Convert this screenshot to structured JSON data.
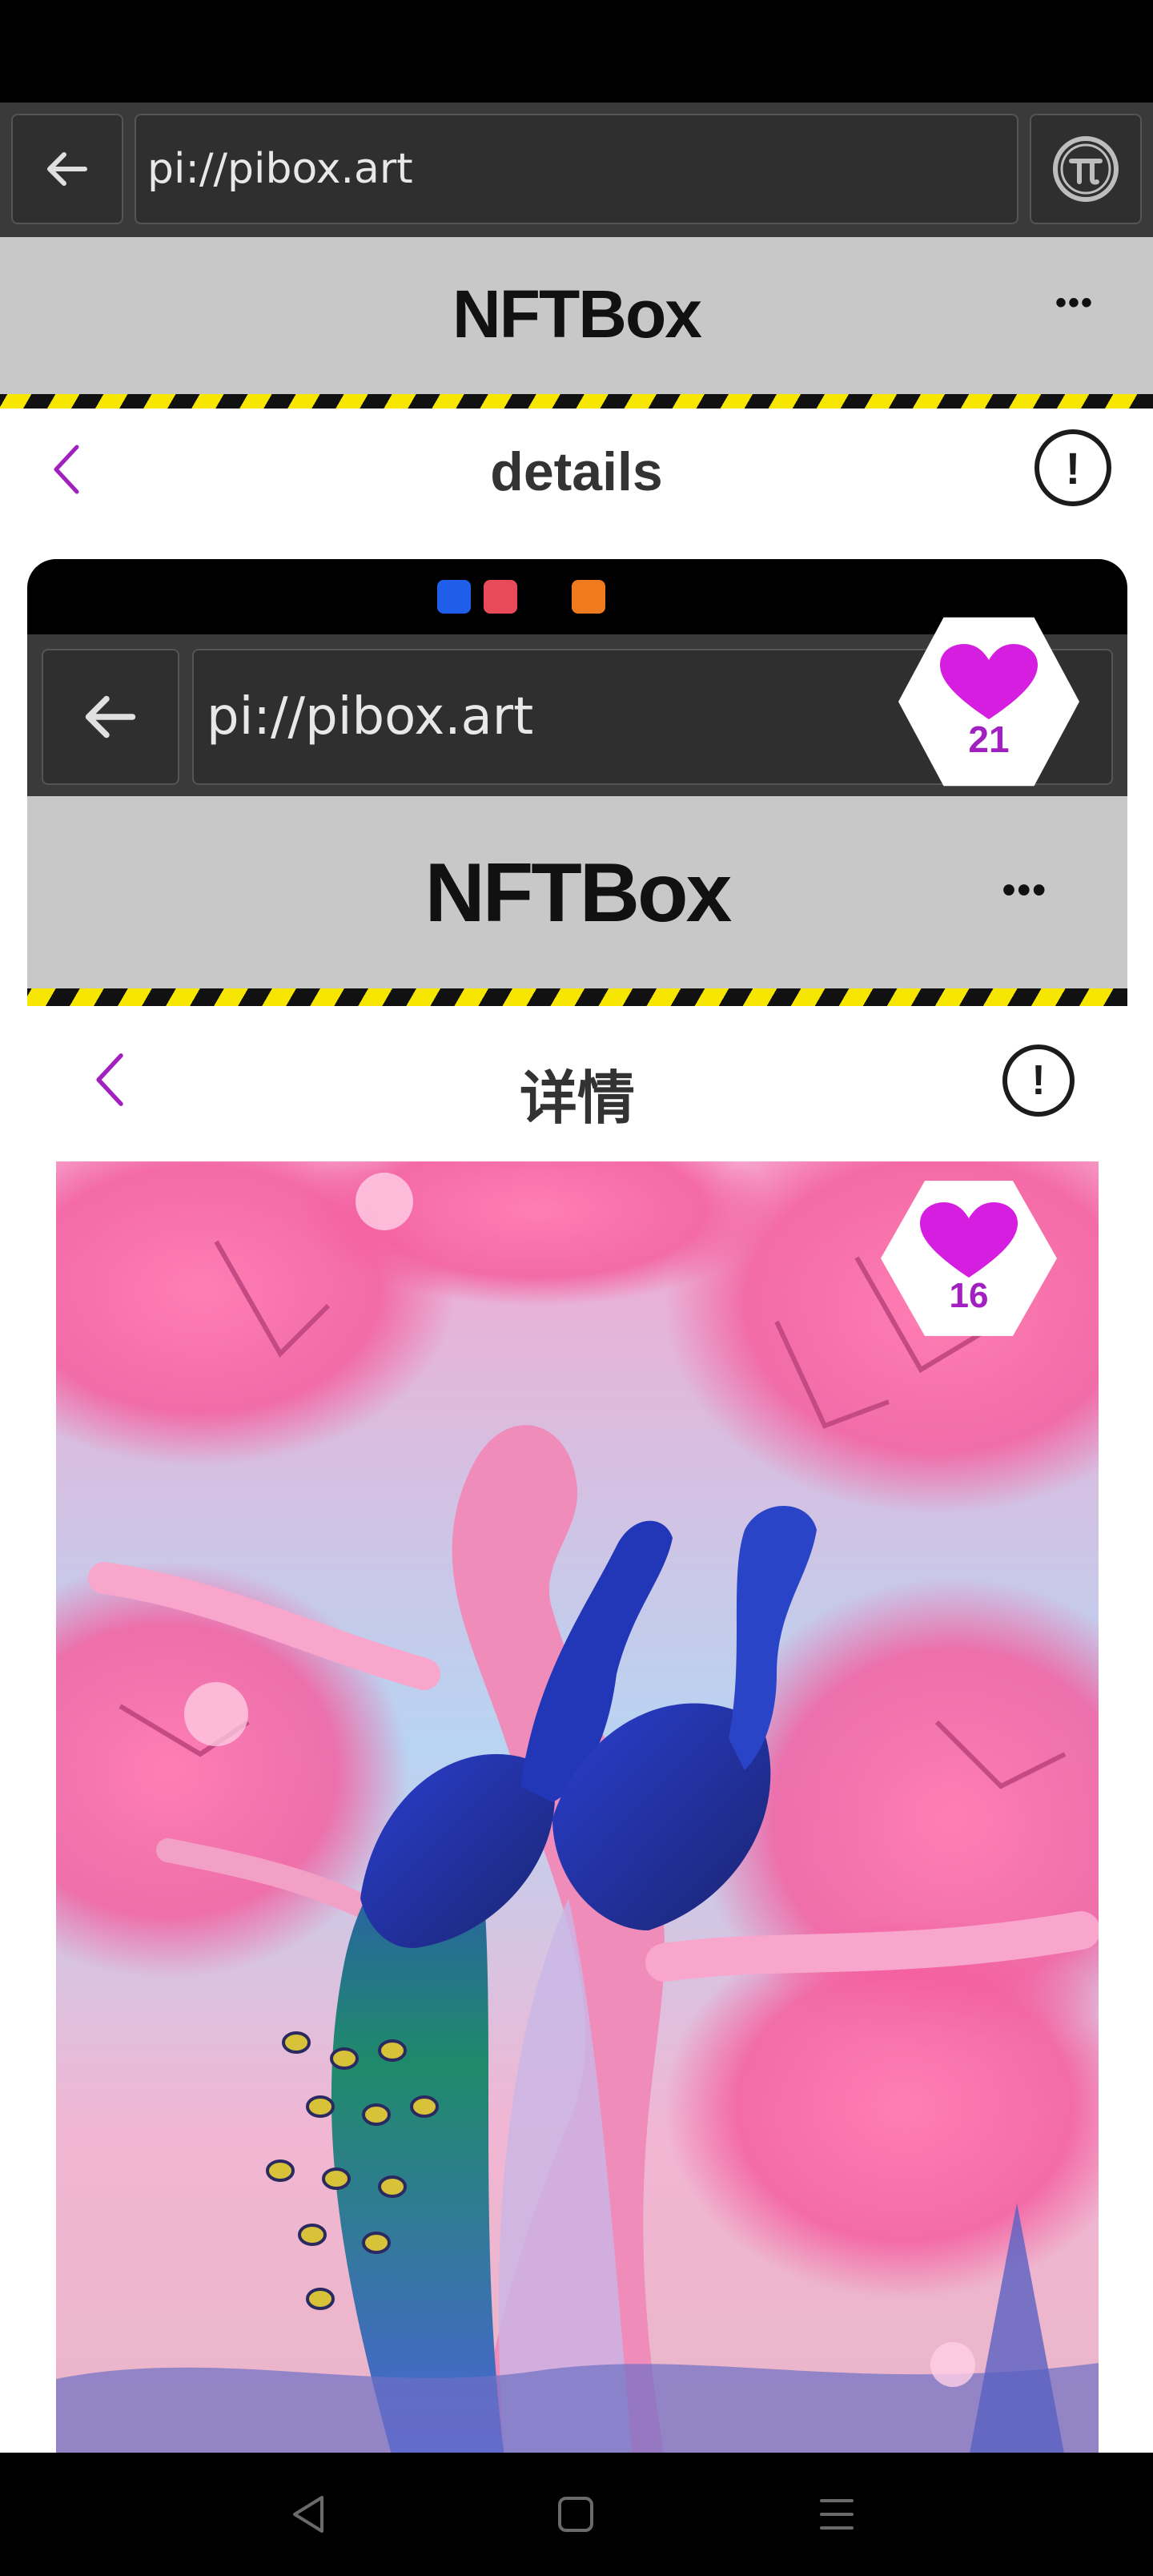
{
  "browser": {
    "url": "pi://pibox.art",
    "back_icon": "arrow-left-icon",
    "pi_icon": "pi-logo-icon"
  },
  "app": {
    "title": "NFTBox",
    "more_label": "•••"
  },
  "details": {
    "title": "details",
    "back_icon": "chevron-left-icon",
    "report_icon": "exclamation-circle-icon"
  },
  "like_badge": {
    "count": "21"
  },
  "inner_screenshot": {
    "url": "pi://pibox.art",
    "app_title": "NFTBox",
    "more_label": "•••",
    "details_title": "详情",
    "like_count": "16",
    "artwork_description_icon": "peacock-artwork"
  },
  "colors": {
    "accent": "#a020c0",
    "heart": "#d61ee0",
    "header_bg": "#c8c8c8",
    "hazard_yellow": "#f6e600"
  }
}
